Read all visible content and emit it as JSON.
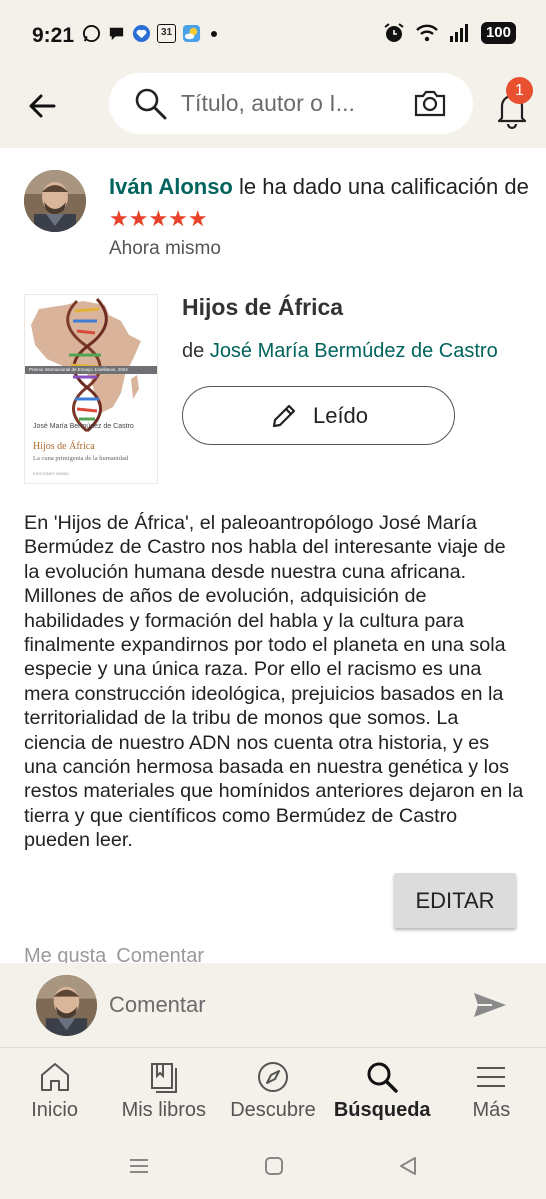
{
  "status_bar": {
    "time": "9:21",
    "calendar_day": "31",
    "battery": "100"
  },
  "header": {
    "search_placeholder": "Título, autor o I...",
    "notification_count": "1"
  },
  "activity": {
    "user_name": "Iván Alonso",
    "action_text": " le ha dado una calificación de ",
    "stars": "★★★★★",
    "rating": 5,
    "timestamp": "Ahora mismo"
  },
  "book": {
    "title": "Hijos de África",
    "by_label": "de ",
    "author": "José María Bermúdez de Castro",
    "status_label": "Leído",
    "cover": {
      "author": "José María Bermúdez de Castro",
      "title": "Hijos de África",
      "subtitle": "La cuna primigenia de la humanidad",
      "band": "Premio Internacional de Ensayo Jovellanos, 2024",
      "publisher": "EDICIONES NOBEL"
    }
  },
  "review": {
    "text": "En 'Hijos de África', el paleoantropólogo José María Bermúdez de Castro nos habla del interesante viaje de la evolución humana desde nuestra cuna africana. Millones de años de evolución, adquisición de habilidades y formación del habla y la cultura para finalmente expandirnos por todo el planeta en una sola especie y una única raza. Por ello el racismo es una mera construcción ideológica, prejuicios basados en la territorialidad de la tribu de monos que somos. La ciencia de nuestro ADN nos cuenta otra historia, y es una canción hermosa basada en nuestra genética y los restos materiales que homínidos anteriores dejaron en la tierra y que científicos como Bermúdez de Castro pueden leer.",
    "edit_label": "EDITAR",
    "like_label": "Me gusta",
    "comment_label": "Comentar"
  },
  "comment_bar": {
    "placeholder": "Comentar"
  },
  "bottom_nav": {
    "items": [
      {
        "label": "Inicio",
        "icon": "home-icon"
      },
      {
        "label": "Mis libros",
        "icon": "books-icon"
      },
      {
        "label": "Descubre",
        "icon": "compass-icon"
      },
      {
        "label": "Búsqueda",
        "icon": "search-icon"
      },
      {
        "label": "Más",
        "icon": "menu-icon"
      }
    ],
    "active": "Búsqueda"
  },
  "colors": {
    "accent_link": "#00635d",
    "star": "#e8422a",
    "badge": "#e8502f",
    "bar_bg": "#f4f1ea"
  }
}
